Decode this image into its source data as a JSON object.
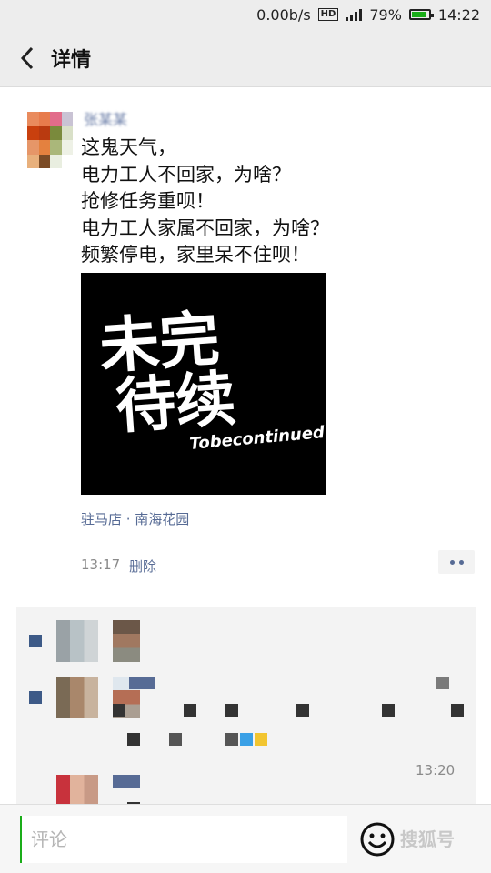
{
  "status_bar": {
    "network_speed": "0.00b/s",
    "network_type": "HD",
    "battery": "79%",
    "clock": "14:22"
  },
  "header": {
    "back_icon": "back-arrow-icon",
    "title": "详情"
  },
  "post": {
    "author": "张某某",
    "lines": [
      "这鬼天气，",
      "电力工人不回家，为啥？",
      "抢修任务重呗！",
      "电力工人家属不回家，为啥？",
      "频繁停电，家里呆不住呗！"
    ],
    "image_text": {
      "chinese_top": "未完",
      "chinese_bottom": "待续",
      "english": "Tobecontinued"
    },
    "location": "驻马店 · 南海花园",
    "time": "13:17",
    "delete_label": "删除",
    "more_icon": "more-dots-icon"
  },
  "comments": {
    "time": "13:20"
  },
  "bottom_bar": {
    "input_placeholder": "评论",
    "emoji_icon": "smiley-icon",
    "watermark": "搜狐号"
  },
  "colors": {
    "link": "#576b95",
    "accent_green": "#1aad19",
    "background": "#ededed"
  }
}
